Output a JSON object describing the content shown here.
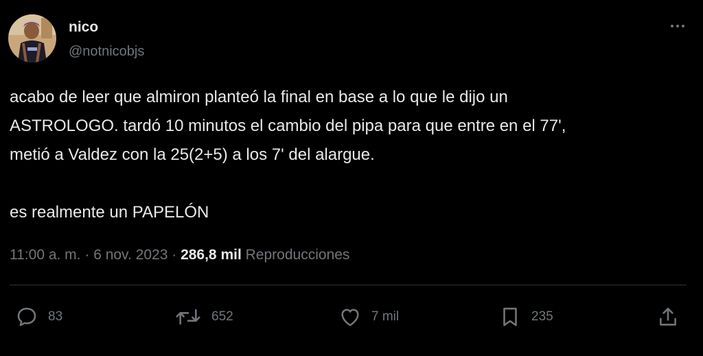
{
  "author": {
    "display_name": "nico",
    "handle": "@notnicobjs",
    "avatar_icon": "profile-photo"
  },
  "tweet": {
    "lines": [
      "acabo de leer que almiron planteó la final en base a lo que le dijo un",
      "ASTROLOGO. tardó 10 minutos el cambio del pipa para que entre en el 77',",
      "metió a Valdez con la 25(2+5) a los 7' del alargue.",
      "es realmente un PAPELÓN"
    ]
  },
  "meta": {
    "time": "11:00 a. m.",
    "separator": " · ",
    "date": "6 nov. 2023",
    "views_count": "286,8 mil",
    "views_label": "Reproducciones"
  },
  "actions": {
    "reply_count": "83",
    "retweet_count": "652",
    "like_count": "7 mil",
    "bookmark_count": "235"
  },
  "colors": {
    "background": "#000000",
    "text_primary": "#e7e9ea",
    "text_secondary": "#71767b",
    "divider": "#2f3336"
  }
}
